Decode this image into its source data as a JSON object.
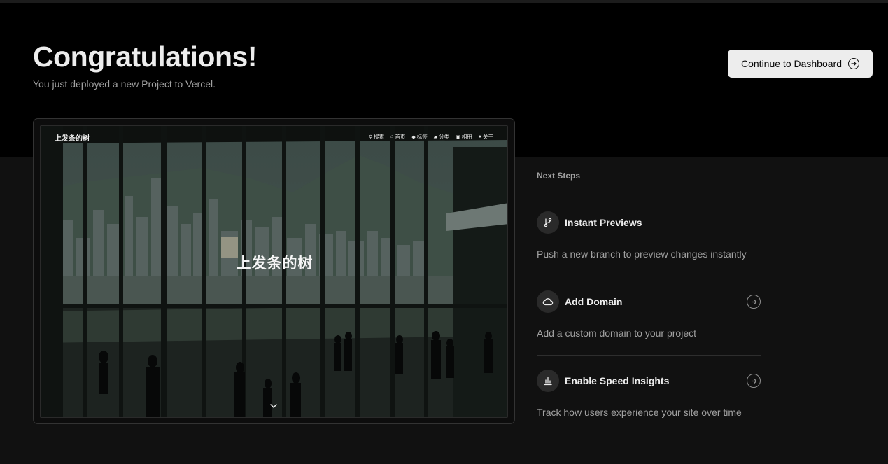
{
  "header": {
    "title": "Congratulations!",
    "subtitle": "You just deployed a new Project to Vercel.",
    "dashboard_button": "Continue to Dashboard"
  },
  "preview": {
    "site_logo": "上发条的树",
    "site_title": "上发条的树",
    "nav": [
      {
        "icon": "search-icon",
        "label": "搜索"
      },
      {
        "icon": "home-icon",
        "label": "首页"
      },
      {
        "icon": "tag-icon",
        "label": "标签"
      },
      {
        "icon": "folder-icon",
        "label": "分类"
      },
      {
        "icon": "album-icon",
        "label": "相册"
      },
      {
        "icon": "user-icon",
        "label": "关于"
      }
    ]
  },
  "next_steps": {
    "title": "Next Steps",
    "items": [
      {
        "icon": "git-branch-icon",
        "label": "Instant Previews",
        "description": "Push a new branch to preview changes instantly",
        "has_arrow": false
      },
      {
        "icon": "cloud-icon",
        "label": "Add Domain",
        "description": "Add a custom domain to your project",
        "has_arrow": true
      },
      {
        "icon": "bar-chart-icon",
        "label": "Enable Speed Insights",
        "description": "Track how users experience your site over time",
        "has_arrow": true
      }
    ]
  },
  "colors": {
    "background": "#000000",
    "panel": "#111111",
    "button_bg": "#ededed",
    "muted_text": "#a1a1a1"
  }
}
